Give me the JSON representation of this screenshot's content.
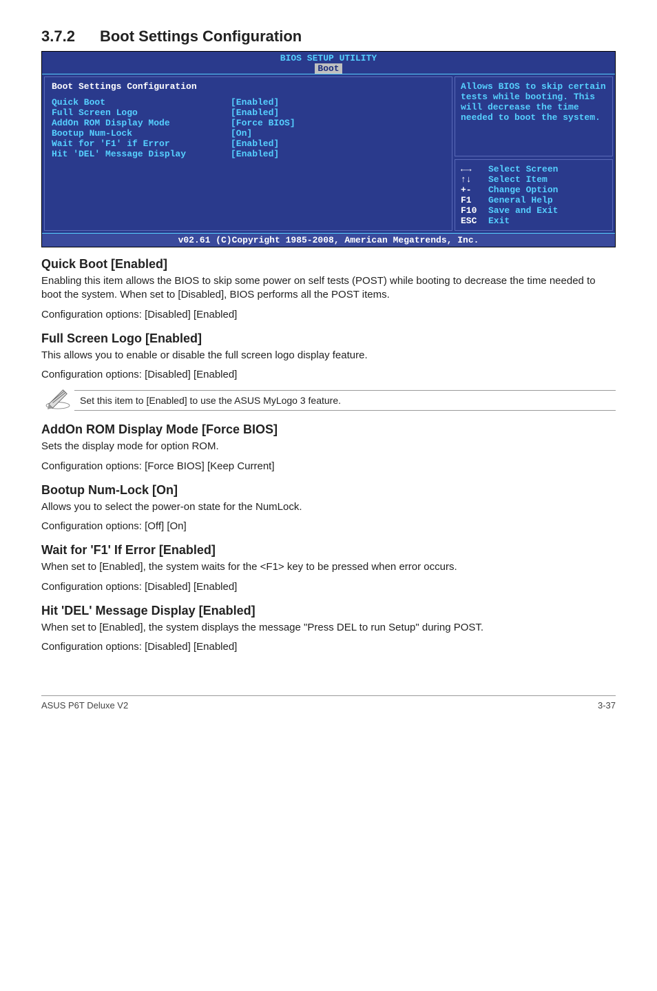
{
  "section": {
    "number": "3.7.2",
    "title": "Boot Settings Configuration"
  },
  "bios": {
    "header_title": "BIOS SETUP UTILITY",
    "active_tab": "Boot",
    "config_heading": "Boot Settings Configuration",
    "items": [
      {
        "label": "Quick Boot",
        "value": "[Enabled]"
      },
      {
        "label": "Full Screen Logo",
        "value": "[Enabled]"
      },
      {
        "label": "AddOn ROM Display Mode",
        "value": "[Force BIOS]"
      },
      {
        "label": "Bootup Num-Lock",
        "value": "[On]"
      },
      {
        "label": "Wait for 'F1' if Error",
        "value": "[Enabled]"
      },
      {
        "label": "Hit 'DEL' Message Display",
        "value": "[Enabled]"
      }
    ],
    "help_text": "Allows BIOS to skip certain tests while booting. This will decrease the time needed to boot the system.",
    "nav": [
      {
        "key": "←→",
        "action": "Select Screen"
      },
      {
        "key": "↑↓",
        "action": "Select Item"
      },
      {
        "key": "+-",
        "action": "Change Option"
      },
      {
        "key": "F1",
        "action": "General Help"
      },
      {
        "key": "F10",
        "action": "Save and Exit"
      },
      {
        "key": "ESC",
        "action": "Exit"
      }
    ],
    "footer": "v02.61 (C)Copyright 1985-2008, American Megatrends, Inc."
  },
  "sections": {
    "quick_boot": {
      "heading": "Quick Boot [Enabled]",
      "body": "Enabling this item allows the BIOS to skip some power on self tests (POST) while booting to decrease the time needed to boot the system. When set to [Disabled], BIOS performs all the POST items.",
      "opts": "Configuration options: [Disabled] [Enabled]"
    },
    "full_screen_logo": {
      "heading": "Full Screen Logo [Enabled]",
      "body": "This allows you to enable or disable the full screen logo display feature.",
      "opts": "Configuration options: [Disabled] [Enabled]"
    },
    "note": "Set this item to [Enabled] to use the ASUS MyLogo 3 feature.",
    "addon_rom": {
      "heading": "AddOn ROM Display Mode [Force BIOS]",
      "body": "Sets the display mode for option ROM.",
      "opts": "Configuration options: [Force BIOS] [Keep Current]"
    },
    "bootup_numlock": {
      "heading": "Bootup Num-Lock [On]",
      "body": "Allows you to select the power-on state for the NumLock.",
      "opts": "Configuration options: [Off] [On]"
    },
    "wait_f1": {
      "heading": "Wait for 'F1' If Error [Enabled]",
      "body": "When set to [Enabled], the system waits for the <F1> key to be pressed when error occurs.",
      "opts": "Configuration options: [Disabled] [Enabled]"
    },
    "hit_del": {
      "heading": "Hit 'DEL' Message Display [Enabled]",
      "body": "When set to [Enabled], the system displays the message \"Press DEL to run Setup\" during POST.",
      "opts": "Configuration options: [Disabled] [Enabled]"
    }
  },
  "footer": {
    "left": "ASUS P6T Deluxe V2",
    "right": "3-37"
  }
}
